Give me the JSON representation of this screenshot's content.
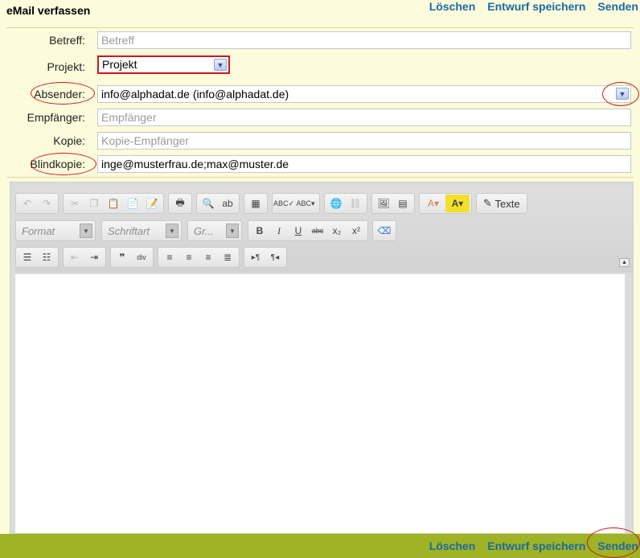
{
  "page": {
    "title": "eMail verfassen"
  },
  "actions": {
    "delete": "Löschen",
    "save_draft": "Entwurf speichern",
    "send": "Senden"
  },
  "form": {
    "subject": {
      "label": "Betreff:",
      "placeholder": "Betreff"
    },
    "project": {
      "label": "Projekt:",
      "value": "Projekt"
    },
    "sender": {
      "label": "Absender:",
      "value": "info@alphadat.de (info@alphadat.de)"
    },
    "recipient": {
      "label": "Empfänger:",
      "placeholder": "Empfänger"
    },
    "cc": {
      "label": "Kopie:",
      "placeholder": "Kopie-Empfänger"
    },
    "bcc": {
      "label": "Blindkopie:",
      "value": "inge@musterfrau.de;max@muster.de"
    }
  },
  "editor": {
    "format": "Format",
    "font": "Schriftart",
    "size": "Gr...",
    "texte": "Texte"
  },
  "colors": {
    "accent_red": "#c71a1a",
    "link_blue": "#1a6aa6",
    "footer_green": "#9eb325",
    "page_bg": "#fcfbdc"
  }
}
